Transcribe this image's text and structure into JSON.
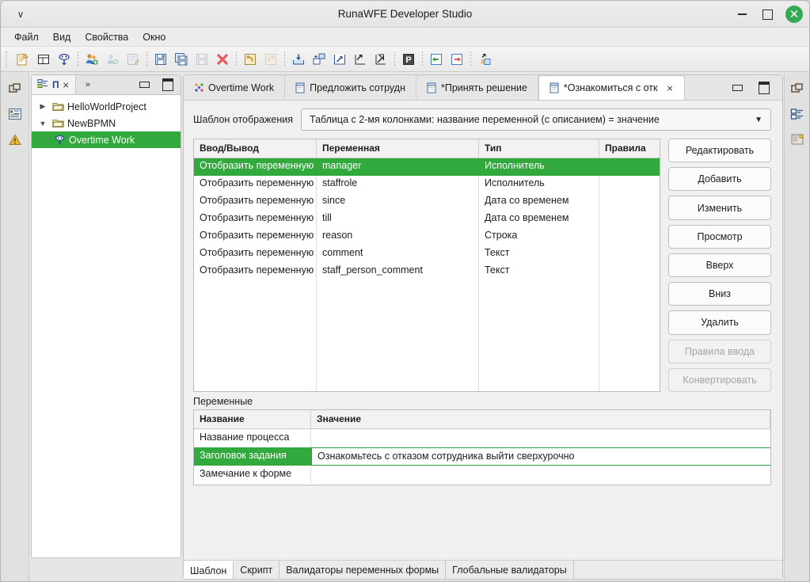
{
  "window": {
    "title": "RunaWFE Developer Studio",
    "menu_chevron": "∨",
    "buttons": {
      "minimize": "minimize-button",
      "maximize": "maximize-button",
      "close": "✕"
    }
  },
  "menubar": {
    "items": [
      "Файл",
      "Вид",
      "Свойства",
      "Окно"
    ]
  },
  "toolbar": {
    "groups": [
      [
        "new-process-icon",
        "new-form-icon",
        "new-bpmn-process-icon"
      ],
      [
        "manage-users-icon",
        "add-user-icon",
        "edit-properties-icon"
      ],
      [
        "save-icon",
        "save-all-icon",
        "save-as-icon",
        "delete-icon"
      ],
      [
        "undo-icon",
        "redo-icon"
      ],
      [
        "import-icon",
        "import-from-server-icon",
        "export-icon",
        "import-par-icon",
        "export-par-icon"
      ],
      [
        "p-marker-icon"
      ],
      [
        "import-left-icon",
        "export-right-icon"
      ],
      [
        "export-xpdl-icon"
      ]
    ]
  },
  "left_rail": {
    "icons": [
      "restore-view-icon",
      "properties-view-icon",
      "warning-view-icon"
    ]
  },
  "right_rail": {
    "icons": [
      "restore-view-icon",
      "outline-view-icon",
      "palette-view-icon"
    ]
  },
  "tree_panel": {
    "tab": {
      "icon": "project-explorer-icon",
      "letter": "П",
      "close": "⨯"
    },
    "tools": {
      "chevron": "»",
      "minimize": "minimize-view-button",
      "maximize": "maximize-view-button"
    },
    "nodes": [
      {
        "label": "HelloWorldProject",
        "icon": "folder-icon",
        "arrow": "▶",
        "depth": 0,
        "selected": false
      },
      {
        "label": "NewBPMN",
        "icon": "folder-icon",
        "arrow": "▼",
        "depth": 0,
        "selected": false
      },
      {
        "label": "Overtime Work",
        "icon": "process-icon",
        "arrow": "",
        "depth": 1,
        "selected": true
      }
    ]
  },
  "editor": {
    "tabs": [
      {
        "label": "Overtime Work",
        "icon": "diagram-icon",
        "active": false,
        "closable": false
      },
      {
        "label": "Предложить сотрудн",
        "icon": "form-icon",
        "active": false,
        "closable": false
      },
      {
        "label": "*Принять решение",
        "icon": "form-icon",
        "active": false,
        "closable": false
      },
      {
        "label": "*Ознакомиться с отк",
        "icon": "form-icon",
        "active": true,
        "closable": true,
        "close": "⨯"
      }
    ],
    "tab_window_buttons": {
      "minimize": "minimize-editor-button",
      "maximize": "maximize-editor-button"
    }
  },
  "template_row": {
    "label": "Шаблон отображения",
    "value": "Таблица с 2-мя колонками: название переменной (с описанием) = значение",
    "arrow": "▼"
  },
  "grid": {
    "headers": [
      "Ввод/Вывод",
      "Переменная",
      "Тип",
      "Правила"
    ],
    "rows": [
      {
        "io": "Отобразить переменную",
        "variable": "manager",
        "type": "Исполнитель",
        "rules": "",
        "selected": true
      },
      {
        "io": "Отобразить переменную",
        "variable": "staffrole",
        "type": "Исполнитель",
        "rules": "",
        "selected": false
      },
      {
        "io": "Отобразить переменную",
        "variable": "since",
        "type": "Дата со временем",
        "rules": "",
        "selected": false
      },
      {
        "io": "Отобразить переменную",
        "variable": "till",
        "type": "Дата со временем",
        "rules": "",
        "selected": false
      },
      {
        "io": "Отобразить переменную",
        "variable": "reason",
        "type": "Строка",
        "rules": "",
        "selected": false
      },
      {
        "io": "Отобразить переменную",
        "variable": "comment",
        "type": "Текст",
        "rules": "",
        "selected": false
      },
      {
        "io": "Отобразить переменную",
        "variable": "staff_person_comment",
        "type": "Текст",
        "rules": "",
        "selected": false
      }
    ]
  },
  "side_buttons": [
    {
      "label": "Редактировать",
      "enabled": true
    },
    {
      "label": "Добавить",
      "enabled": true
    },
    {
      "label": "Изменить",
      "enabled": true
    },
    {
      "label": "Просмотр",
      "enabled": true
    },
    {
      "label": "Вверх",
      "enabled": true
    },
    {
      "label": "Вниз",
      "enabled": true
    },
    {
      "label": "Удалить",
      "enabled": true
    },
    {
      "label": "Правила ввода",
      "enabled": false
    },
    {
      "label": "Конвертировать",
      "enabled": false
    }
  ],
  "variables": {
    "section_label": "Переменные",
    "headers": [
      "Название",
      "Значение"
    ],
    "rows": [
      {
        "name": "Название процесса",
        "value": "",
        "selected": false
      },
      {
        "name": "Заголовок задания",
        "value": "Ознакомьтесь с отказом сотрудника выйти сверхурочно",
        "selected": true
      },
      {
        "name": "Замечание к форме",
        "value": "",
        "selected": false
      }
    ]
  },
  "bottom_tabs": [
    {
      "label": "Шаблон",
      "active": true
    },
    {
      "label": "Скрипт",
      "active": false
    },
    {
      "label": "Валидаторы переменных формы",
      "active": false
    },
    {
      "label": "Глобальные валидаторы",
      "active": false
    }
  ],
  "colors": {
    "selection_green": "#31a93c",
    "close_button_green": "#34a853",
    "window_bg": "#e9e9e9",
    "grid_bg": "#ffffff"
  }
}
